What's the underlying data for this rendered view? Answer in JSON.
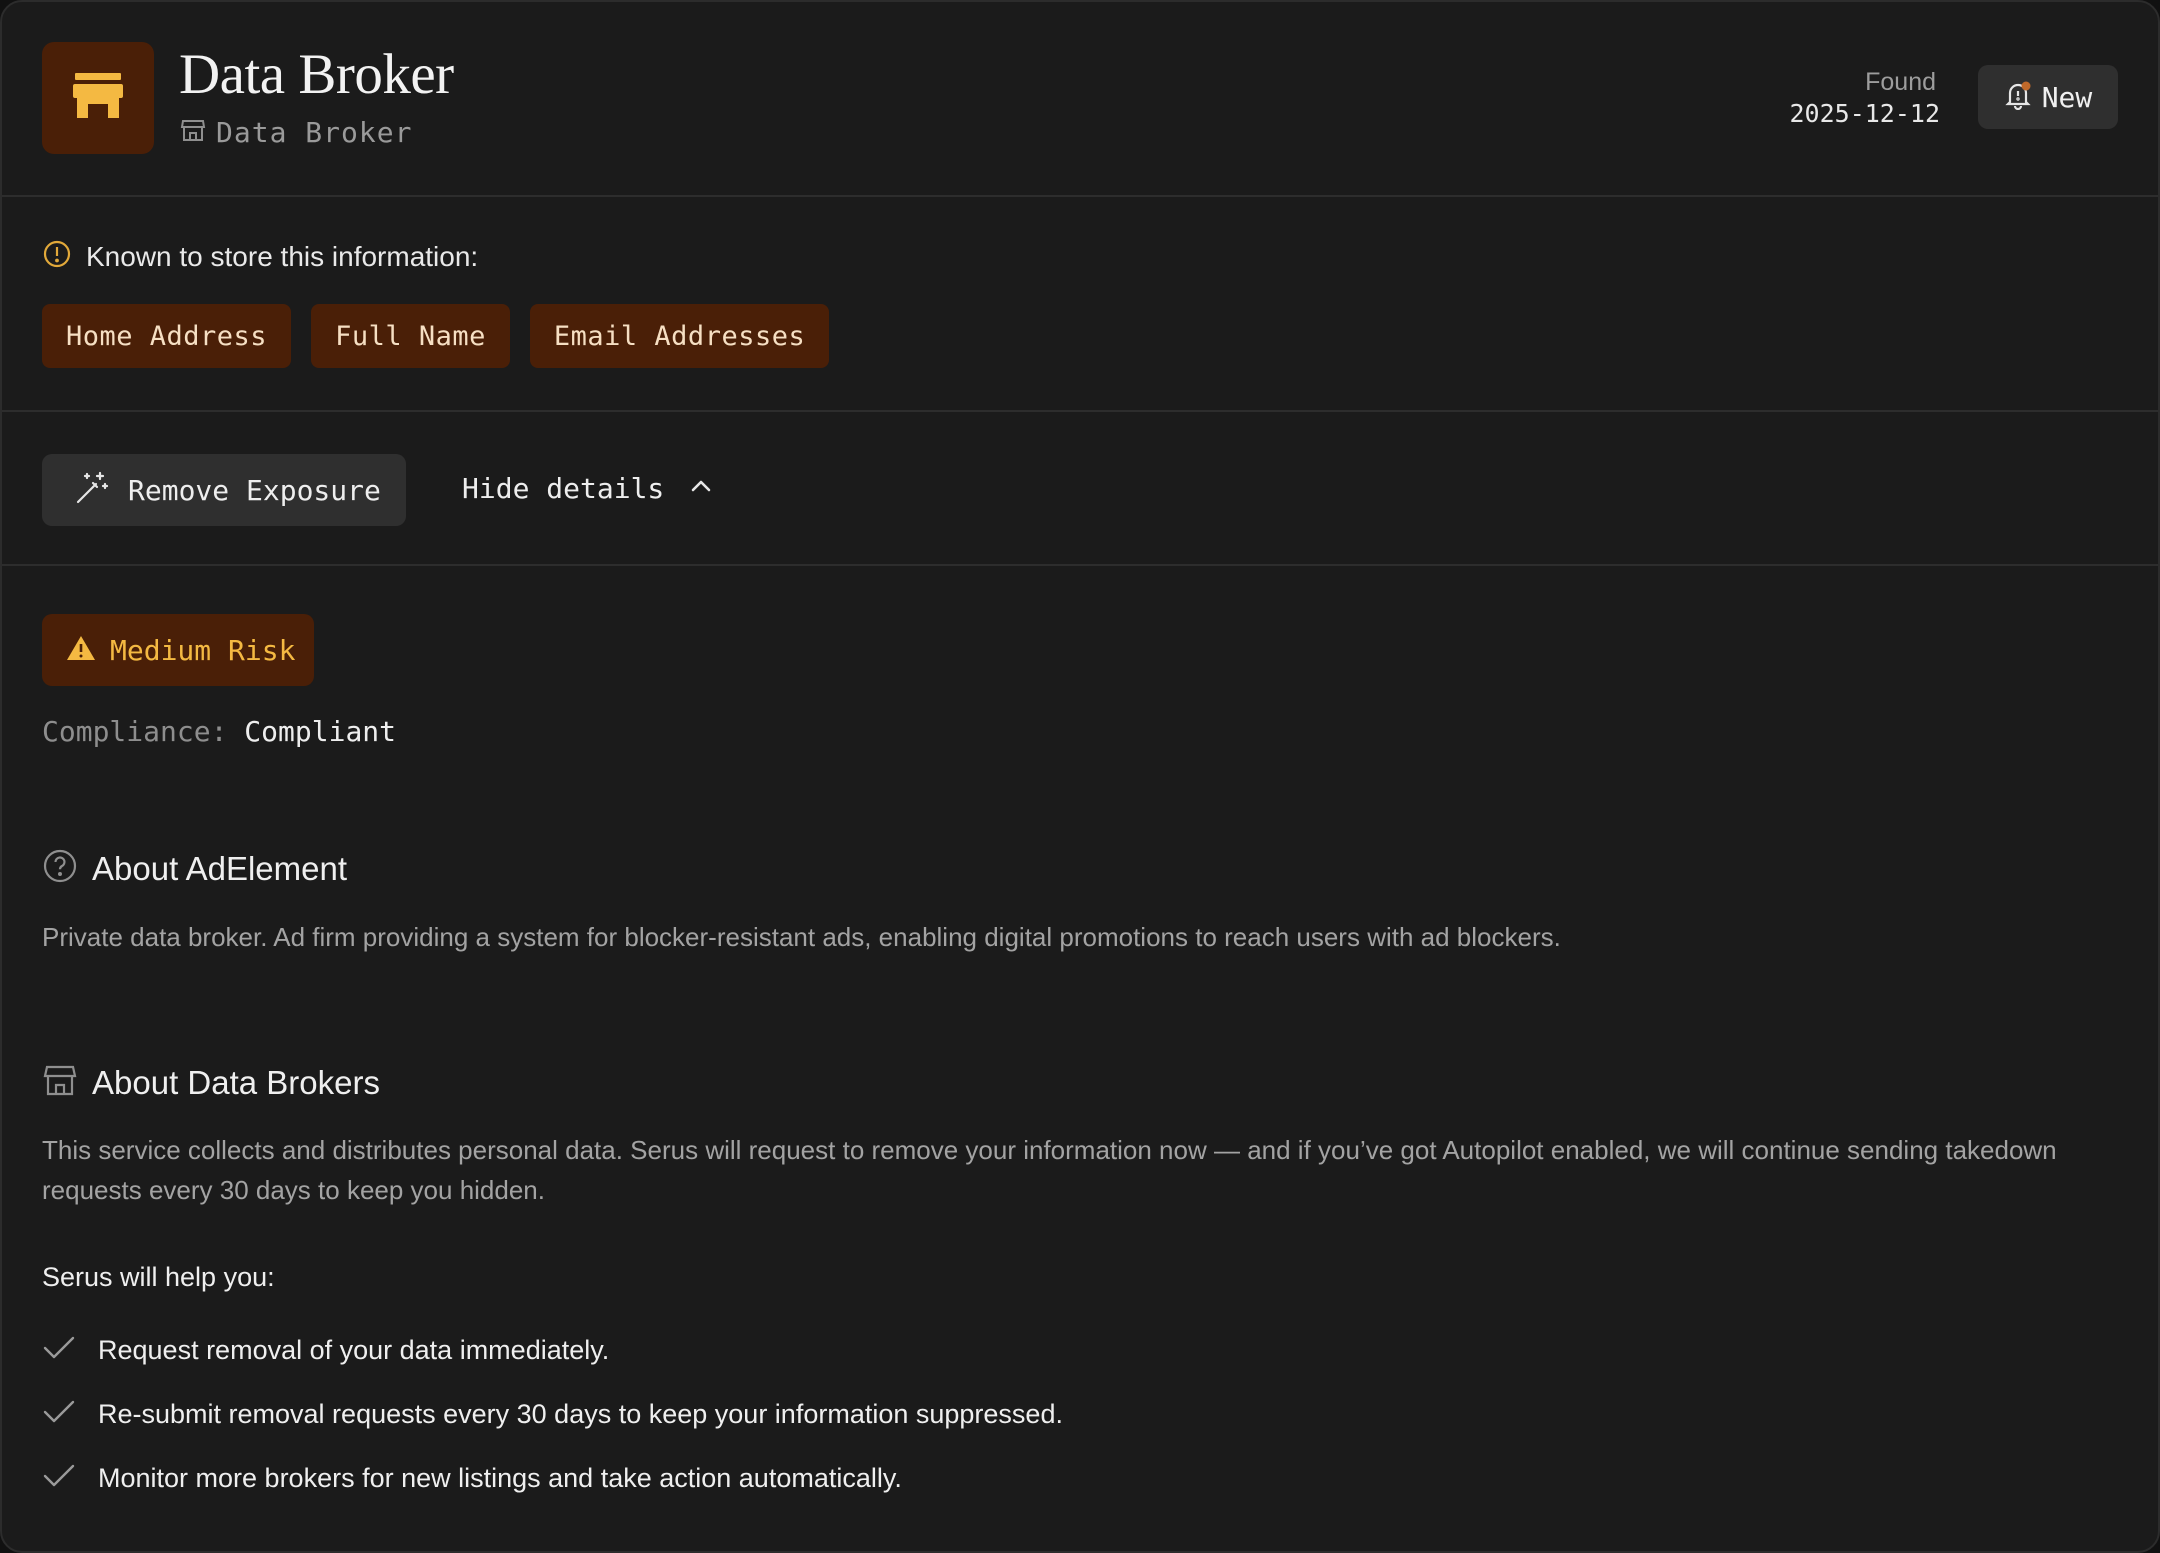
{
  "header": {
    "title": "Data Broker",
    "subtitle": "Data Broker",
    "found_label": "Found",
    "found_date": "2025-12-12",
    "new_label": "New"
  },
  "known": {
    "heading": "Known to store this information:",
    "chips": [
      "Home Address",
      "Full Name",
      "Email Addresses"
    ]
  },
  "actions": {
    "remove_label": "Remove Exposure",
    "hide_label": "Hide details"
  },
  "risk": {
    "label": "Medium Risk",
    "compliance_label": "Compliance:",
    "compliance_value": "Compliant"
  },
  "about_company": {
    "title": "About AdElement",
    "body": "Private data broker. Ad firm providing a system for blocker-resistant ads, enabling digital promotions to reach users with ad blockers."
  },
  "about_brokers": {
    "title": "About Data Brokers",
    "body": "This service collects and distributes personal data. Serus will request to remove your information now — and if you’ve got Autopilot enabled, we will continue sending takedown requests every 30 days to keep you hidden.",
    "help_heading": "Serus will help you:",
    "help_items": [
      "Request removal of your data immediately.",
      "Re-submit removal requests every 30 days to keep your information suppressed.",
      "Monitor more brokers for new listings and take action automatically."
    ]
  },
  "colors": {
    "background": "#1b1b1b",
    "accent_bg": "#4a1f07",
    "accent": "#f4b942",
    "chip_text": "#f6dfc3",
    "button_bg": "#2f2f2f"
  },
  "icons": {
    "logo": "store-icon",
    "subtitle": "store-icon",
    "new": "bell-alert-icon",
    "known": "alert-circle-icon",
    "remove": "magic-wand-icon",
    "hide": "chevron-up-icon",
    "risk": "warning-triangle-icon",
    "about_company": "help-circle-icon",
    "about_brokers": "store-icon",
    "help_item": "check-icon"
  }
}
